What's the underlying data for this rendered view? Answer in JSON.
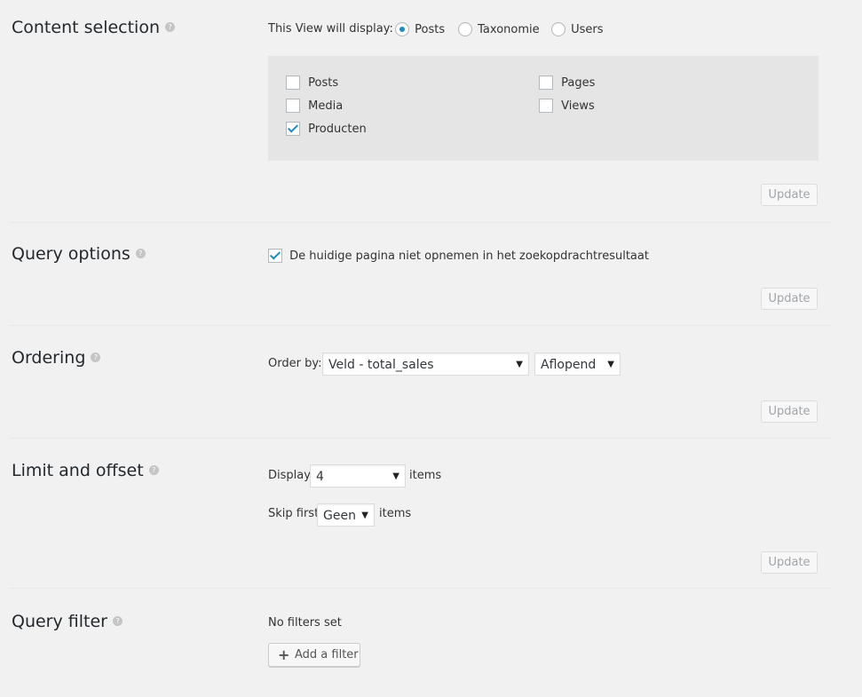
{
  "content_selection": {
    "title": "Content selection",
    "display_label": "This View will display:",
    "radios": [
      {
        "label": "Posts",
        "checked": true
      },
      {
        "label": "Taxonomie",
        "checked": false
      },
      {
        "label": "Users",
        "checked": false
      }
    ],
    "post_types": [
      {
        "label": "Posts",
        "checked": false
      },
      {
        "label": "Media",
        "checked": false
      },
      {
        "label": "Producten",
        "checked": true
      },
      {
        "label": "Pages",
        "checked": false
      },
      {
        "label": "Views",
        "checked": false
      }
    ],
    "update_label": "Update"
  },
  "query_options": {
    "title": "Query options",
    "exclude_label": "De huidige pagina niet opnemen in het zoekopdrachtresultaat",
    "exclude_checked": true,
    "update_label": "Update"
  },
  "ordering": {
    "title": "Ordering",
    "order_by_label": "Order by:",
    "order_by_value": "Veld - total_sales",
    "direction_value": "Aflopend",
    "update_label": "Update"
  },
  "limit_offset": {
    "title": "Limit and offset",
    "display_label": "Display",
    "display_value": "4",
    "items_label": "items",
    "skip_label": "Skip first",
    "skip_value": "Geen",
    "skip_items_label": "items",
    "update_label": "Update"
  },
  "query_filter": {
    "title": "Query filter",
    "no_filters_text": "No filters set",
    "add_filter_label": "Add a filter"
  },
  "help_glyph": "?",
  "dropdown_glyph": "▼",
  "plus_glyph": "+",
  "colors": {
    "background": "#f1f1f1",
    "accent": "#1e8cbe",
    "panel": "#e5e5e5"
  }
}
